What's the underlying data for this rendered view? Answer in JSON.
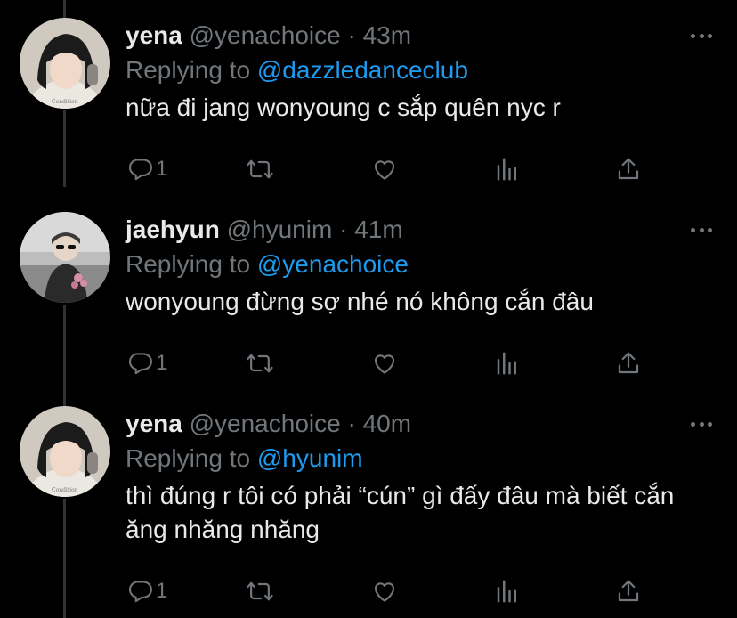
{
  "colors": {
    "background": "#000000",
    "text": "#e7e9ea",
    "secondary": "#71767b",
    "link": "#1d9bf0"
  },
  "tweets": [
    {
      "name": "yena",
      "handle": "@yenachoice",
      "separator": "·",
      "time": "43m",
      "replying_prefix": "Replying to",
      "replying_to": "@dazzledanceclub",
      "text": "nữa đi jang wonyoung c sắp quên nyc r",
      "reply_count": "1",
      "avatar": "avatar-yena"
    },
    {
      "name": "jaehyun",
      "handle": "@hyunim",
      "separator": "·",
      "time": "41m",
      "replying_prefix": "Replying to",
      "replying_to": "@yenachoice",
      "text": "wonyoung đừng sợ nhé nó không cắn đâu",
      "reply_count": "1",
      "avatar": "avatar-jaehyun"
    },
    {
      "name": "yena",
      "handle": "@yenachoice",
      "separator": "·",
      "time": "40m",
      "replying_prefix": "Replying to",
      "replying_to": "@hyunim",
      "text": "thì đúng r tôi có phải “cún” gì đấy đâu mà biết cắn ăng nhăng nhăng",
      "reply_count": "1",
      "avatar": "avatar-yena"
    }
  ],
  "icons": [
    "reply-icon",
    "retweet-icon",
    "like-icon",
    "analytics-icon",
    "share-icon",
    "more-icon"
  ]
}
